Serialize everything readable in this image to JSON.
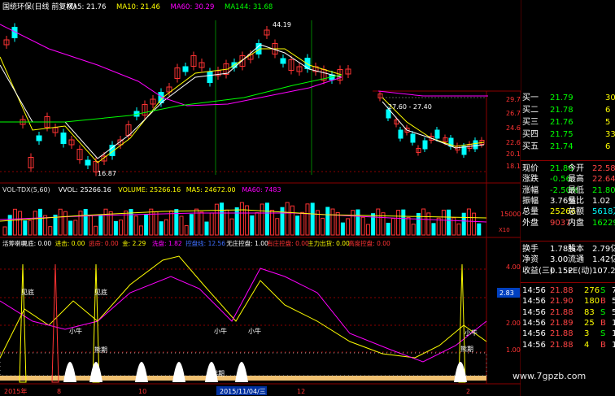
{
  "main_panel": {
    "title": "国统环保(日线 前复权)",
    "ma_labels": [
      {
        "text": "MA5: 21.76",
        "color": "#ffffff"
      },
      {
        "text": "MA10: 21.46",
        "color": "#ffff00"
      },
      {
        "text": "MA60: 30.29",
        "color": "#ff00ff"
      },
      {
        "text": "MA144: 31.68",
        "color": "#00ff00"
      }
    ],
    "annotations": {
      "high": "44.19",
      "low": "16.87",
      "range": "27.60 - 27.40"
    },
    "price_ticks": [
      "29.76",
      "26.76",
      "24.60",
      "22.60",
      "20.12",
      "18.11"
    ]
  },
  "volume_panel": {
    "labels": [
      {
        "text": "VOL-TDX(5,60)",
        "color": "#dddddd"
      },
      {
        "text": "VVOL: 25266.16",
        "color": "#ffffff"
      },
      {
        "text": "VOLUME: 25266.16",
        "color": "#ffff00"
      },
      {
        "text": "MA5: 24672.00",
        "color": "#ffff00"
      },
      {
        "text": "MA60: 7483",
        "color": "#ff00ff"
      }
    ],
    "tick_top": "15000",
    "tick_unit": "X10"
  },
  "indicator_panel": {
    "labels": [
      {
        "text": "活筹喇叭",
        "color": "#ffffff"
      },
      {
        "text": "见底: 0.00",
        "color": "#ffffff"
      },
      {
        "text": "进击: 0.00",
        "color": "#ffff00"
      },
      {
        "text": "逃命: 0.00",
        "color": "#ff3333"
      },
      {
        "text": "金: 2.29",
        "color": "#ffff00"
      },
      {
        "text": "洗盘: 1.82",
        "color": "#ff00ff"
      },
      {
        "text": "控盘线: 12.56",
        "color": "#3f6fff"
      },
      {
        "text": "无庄控盘: 1.00",
        "color": "#ffffff"
      },
      {
        "text": "有庄控盘: 0.00",
        "color": "#ff3333"
      },
      {
        "text": "主力出货: 0.00",
        "color": "#ffff00"
      },
      {
        "text": "高度控盘: 0.00",
        "color": "#ff3333"
      }
    ],
    "signals": [
      "见底",
      "见底",
      "小牛",
      "小牛",
      "小牛",
      "小牛",
      "熊期",
      "熊期",
      "熊期"
    ],
    "ticks": [
      "4.00",
      "3.00",
      "2.00",
      "1.00"
    ],
    "current_value": "2.83"
  },
  "date_axis": [
    "2015年",
    "8",
    "10",
    "2015/11/04/三",
    "12",
    "2"
  ],
  "side_panel": {
    "rows": [
      {
        "cells": [
          {
            "t": "买一",
            "c": "#ffffff"
          },
          {
            "t": "21.79",
            "c": "#00ff00"
          },
          {
            "t": "30",
            "c": "#ffff00"
          }
        ]
      },
      {
        "cells": [
          {
            "t": "买二",
            "c": "#ffffff"
          },
          {
            "t": "21.78",
            "c": "#00ff00"
          },
          {
            "t": "6",
            "c": "#ffff00"
          }
        ]
      },
      {
        "cells": [
          {
            "t": "买三",
            "c": "#ffffff"
          },
          {
            "t": "21.76",
            "c": "#00ff00"
          },
          {
            "t": "5",
            "c": "#ffff00"
          }
        ]
      },
      {
        "cells": [
          {
            "t": "买四",
            "c": "#ffffff"
          },
          {
            "t": "21.75",
            "c": "#00ff00"
          },
          {
            "t": "33",
            "c": "#ffff00"
          }
        ]
      },
      {
        "cells": [
          {
            "t": "买五",
            "c": "#ffffff"
          },
          {
            "t": "21.74",
            "c": "#00ff00"
          },
          {
            "t": "6",
            "c": "#ffff00"
          }
        ]
      },
      {
        "cells": [
          {
            "t": "现价",
            "c": "#ffffff"
          },
          {
            "t": "21.80",
            "c": "#00ff00"
          },
          {
            "t": "今开",
            "c": "#ffffff"
          },
          {
            "t": "22.58",
            "c": "#ff4444"
          }
        ]
      },
      {
        "cells": [
          {
            "t": "涨跌",
            "c": "#ffffff"
          },
          {
            "t": "-0.56",
            "c": "#00ff00"
          },
          {
            "t": "最高",
            "c": "#ffffff"
          },
          {
            "t": "22.64",
            "c": "#ff4444"
          }
        ]
      },
      {
        "cells": [
          {
            "t": "涨幅",
            "c": "#ffffff"
          },
          {
            "t": "-2.50%",
            "c": "#00ff00"
          },
          {
            "t": "最低",
            "c": "#ffffff"
          },
          {
            "t": "21.80",
            "c": "#00ff00"
          }
        ]
      },
      {
        "cells": [
          {
            "t": "振幅",
            "c": "#ffffff"
          },
          {
            "t": "3.76%",
            "c": "#ffffff"
          },
          {
            "t": "量比",
            "c": "#ffffff"
          },
          {
            "t": "1.02",
            "c": "#ffffff"
          }
        ]
      },
      {
        "cells": [
          {
            "t": "总量",
            "c": "#ffffff"
          },
          {
            "t": "25266",
            "c": "#ffff00"
          },
          {
            "t": "总额",
            "c": "#ffffff"
          },
          {
            "t": "5618万",
            "c": "#00ffff"
          }
        ]
      },
      {
        "cells": [
          {
            "t": "外盘",
            "c": "#ffffff"
          },
          {
            "t": "9037",
            "c": "#ff4444"
          },
          {
            "t": "内盘",
            "c": "#ffffff"
          },
          {
            "t": "16229",
            "c": "#00ff00"
          }
        ]
      },
      {
        "cells": [
          {
            "t": "换手",
            "c": "#ffffff"
          },
          {
            "t": "1.78%",
            "c": "#ffffff"
          },
          {
            "t": "股本",
            "c": "#ffffff"
          },
          {
            "t": "2.79亿",
            "c": "#ffffff"
          }
        ]
      },
      {
        "cells": [
          {
            "t": "净资",
            "c": "#ffffff"
          },
          {
            "t": "3.00",
            "c": "#ffffff"
          },
          {
            "t": "流通",
            "c": "#ffffff"
          },
          {
            "t": "1.42亿",
            "c": "#ffffff"
          }
        ]
      },
      {
        "cells": [
          {
            "t": "收益(三)",
            "c": "#ffffff"
          },
          {
            "t": "0.152",
            "c": "#ffffff"
          },
          {
            "t": "PE(动)",
            "c": "#ffffff"
          },
          {
            "t": "107.2",
            "c": "#ffffff"
          }
        ]
      },
      {
        "cells": [
          {
            "t": "14:56",
            "c": "#ffffff"
          },
          {
            "t": "21.88",
            "c": "#ff4444"
          },
          {
            "t": "276",
            "c": "#ffff00"
          },
          {
            "t": "S",
            "c": "#00ff00"
          },
          {
            "t": "7",
            "c": "#ffffff"
          }
        ]
      },
      {
        "cells": [
          {
            "t": "14:56",
            "c": "#ffffff"
          },
          {
            "t": "21.90",
            "c": "#ff4444"
          },
          {
            "t": "180",
            "c": "#ffff00"
          },
          {
            "t": "B",
            "c": "#ff4444"
          },
          {
            "t": "5",
            "c": "#ffffff"
          }
        ]
      },
      {
        "cells": [
          {
            "t": "14:56",
            "c": "#ffffff"
          },
          {
            "t": "21.88",
            "c": "#ff4444"
          },
          {
            "t": "83",
            "c": "#ffff00"
          },
          {
            "t": "S",
            "c": "#00ff00"
          },
          {
            "t": "5",
            "c": "#ffffff"
          }
        ]
      },
      {
        "cells": [
          {
            "t": "14:56",
            "c": "#ffffff"
          },
          {
            "t": "21.89",
            "c": "#ff4444"
          },
          {
            "t": "25",
            "c": "#ffff00"
          },
          {
            "t": "B",
            "c": "#ff4444"
          },
          {
            "t": "1",
            "c": "#ffffff"
          }
        ]
      },
      {
        "cells": [
          {
            "t": "14:56",
            "c": "#ffffff"
          },
          {
            "t": "21.88",
            "c": "#ff4444"
          },
          {
            "t": "3",
            "c": "#ffff00"
          },
          {
            "t": "S",
            "c": "#00ff00"
          },
          {
            "t": "1",
            "c": "#ffffff"
          }
        ]
      },
      {
        "cells": [
          {
            "t": "14:56",
            "c": "#ffffff"
          },
          {
            "t": "21.88",
            "c": "#ff4444"
          },
          {
            "t": "4",
            "c": "#ffff00"
          },
          {
            "t": "B",
            "c": "#ff4444"
          },
          {
            "t": "1",
            "c": "#ffffff"
          }
        ]
      }
    ]
  },
  "watermark": "www.7gpzb.com",
  "colors": {
    "up": "#ff3333",
    "down": "#00ffff",
    "ma5": "#ffffff",
    "ma10": "#ffff00",
    "ma60": "#ff00ff",
    "ma144": "#00ff00",
    "grid": "#8b0000"
  }
}
